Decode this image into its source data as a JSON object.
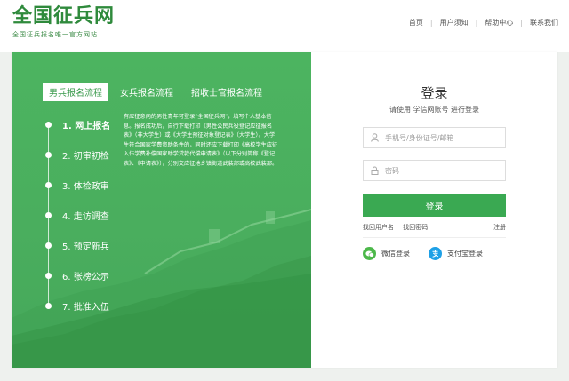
{
  "header": {
    "logo_title": "全国征兵网",
    "logo_subtitle": "全国征兵报名唯一官方网站",
    "nav": [
      "首页",
      "用户须知",
      "帮助中心",
      "联系我们"
    ]
  },
  "tabs": [
    {
      "label": "男兵报名流程",
      "active": true
    },
    {
      "label": "女兵报名流程",
      "active": false
    },
    {
      "label": "招收士官报名流程",
      "active": false
    }
  ],
  "steps": [
    {
      "label": "1. 网上报名",
      "active": true
    },
    {
      "label": "2. 初审初检",
      "active": false
    },
    {
      "label": "3. 体检政审",
      "active": false
    },
    {
      "label": "4. 走访调查",
      "active": false
    },
    {
      "label": "5. 预定新兵",
      "active": false
    },
    {
      "label": "6. 张榜公示",
      "active": false
    },
    {
      "label": "7. 批准入伍",
      "active": false
    }
  ],
  "step_description": "有应征意向的男性青年可登录\"全国征兵网\"，填写个人基本信息。报名成功后，自行下载打印《男性公民兵役登记应征报名表》（非大学生）或《大学生预征对象登记表》（大学生）。大学生符合国家学费资助条件的，同时还应下载打印《高校学生应征入伍学费补偿国家助学贷款代偿申请表》（以下分别简称《登记表》、《申请表》），分别交应征地乡镇街道武装部或高校武装部。",
  "login": {
    "title": "登录",
    "hint": "请使用 学信网账号 进行登录",
    "username_placeholder": "手机号/身份证号/邮箱",
    "password_placeholder": "密码",
    "button": "登录",
    "find_username": "找回用户名",
    "find_password": "找回密码",
    "register": "注册",
    "wechat": "微信登录",
    "alipay": "支付宝登录"
  },
  "colors": {
    "brand_green": "#3aa952",
    "panel_green": "#4cb460",
    "wechat": "#4cb84a",
    "alipay": "#1ea0e6"
  }
}
